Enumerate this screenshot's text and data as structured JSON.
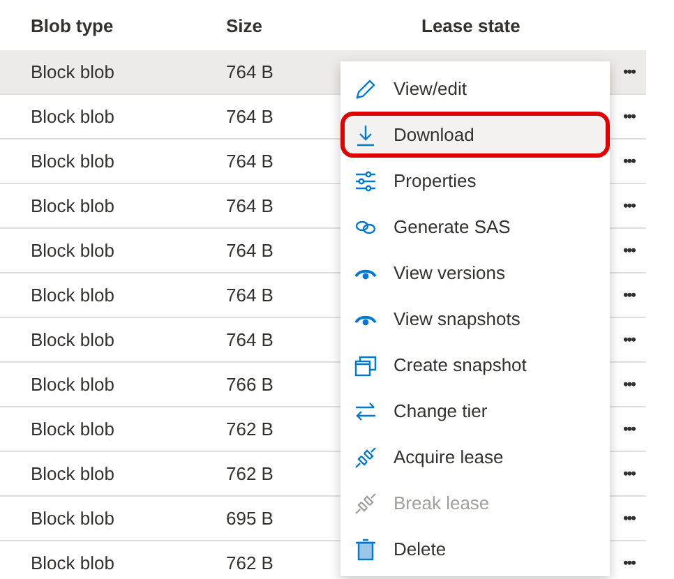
{
  "table": {
    "columns": [
      "Blob type",
      "Size",
      "Lease state"
    ],
    "rows": [
      {
        "type": "Block blob",
        "size": "764 B",
        "selected": true,
        "more": "•••"
      },
      {
        "type": "Block blob",
        "size": "764 B",
        "selected": false,
        "more": "•••"
      },
      {
        "type": "Block blob",
        "size": "764 B",
        "selected": false,
        "more": "•••"
      },
      {
        "type": "Block blob",
        "size": "764 B",
        "selected": false,
        "more": "•••"
      },
      {
        "type": "Block blob",
        "size": "764 B",
        "selected": false,
        "more": "•••"
      },
      {
        "type": "Block blob",
        "size": "764 B",
        "selected": false,
        "more": "•••"
      },
      {
        "type": "Block blob",
        "size": "764 B",
        "selected": false,
        "more": "•••"
      },
      {
        "type": "Block blob",
        "size": "766 B",
        "selected": false,
        "more": "•••"
      },
      {
        "type": "Block blob",
        "size": "762 B",
        "selected": false,
        "more": "•••"
      },
      {
        "type": "Block blob",
        "size": "762 B",
        "selected": false,
        "more": "•••"
      },
      {
        "type": "Block blob",
        "size": "695 B",
        "selected": false,
        "more": "•••"
      },
      {
        "type": "Block blob",
        "size": "762 B",
        "selected": false,
        "more": "•••"
      }
    ]
  },
  "context_menu": {
    "items": [
      {
        "kind": "edit",
        "label": "View/edit",
        "disabled": false,
        "highlighted": false
      },
      {
        "kind": "download",
        "label": "Download",
        "disabled": false,
        "highlighted": true
      },
      {
        "kind": "properties",
        "label": "Properties",
        "disabled": false,
        "highlighted": false
      },
      {
        "kind": "link",
        "label": "Generate SAS",
        "disabled": false,
        "highlighted": false
      },
      {
        "kind": "eye",
        "label": "View versions",
        "disabled": false,
        "highlighted": false
      },
      {
        "kind": "eye",
        "label": "View snapshots",
        "disabled": false,
        "highlighted": false
      },
      {
        "kind": "snapshot",
        "label": "Create snapshot",
        "disabled": false,
        "highlighted": false
      },
      {
        "kind": "swap",
        "label": "Change tier",
        "disabled": false,
        "highlighted": false
      },
      {
        "kind": "plug",
        "label": "Acquire lease",
        "disabled": false,
        "highlighted": false
      },
      {
        "kind": "plug",
        "label": "Break lease",
        "disabled": true,
        "highlighted": false
      },
      {
        "kind": "trash",
        "label": "Delete",
        "disabled": false,
        "highlighted": false
      }
    ]
  }
}
